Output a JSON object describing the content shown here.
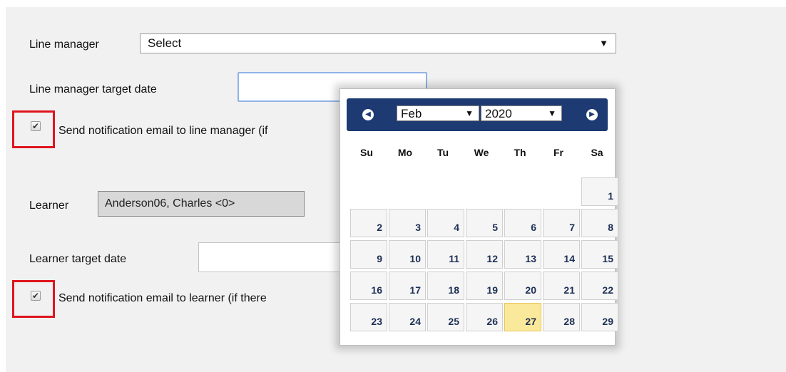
{
  "line_manager": {
    "label": "Line manager",
    "select_value": "Select",
    "arrow": "▼"
  },
  "line_manager_date": {
    "label": "Line manager target date",
    "value": ""
  },
  "line_manager_notify": {
    "label": "Send notification email to line manager (if",
    "checked": true,
    "check_glyph": "✔"
  },
  "learner": {
    "label": "Learner",
    "value": "Anderson06, Charles <0>"
  },
  "learner_date": {
    "label": "Learner target date",
    "value": ""
  },
  "learner_notify": {
    "label": "Send notification email to learner (if there",
    "checked": true,
    "check_glyph": "✔"
  },
  "datepicker": {
    "prev_icon": "◀",
    "next_icon": "▶",
    "month": "Feb",
    "year": "2020",
    "arrow": "▼",
    "weekdays": [
      "Su",
      "Mo",
      "Tu",
      "We",
      "Th",
      "Fr",
      "Sa"
    ],
    "days": [
      "1",
      "2",
      "3",
      "4",
      "5",
      "6",
      "7",
      "8",
      "9",
      "10",
      "11",
      "12",
      "13",
      "14",
      "15",
      "16",
      "17",
      "18",
      "19",
      "20",
      "21",
      "22",
      "23",
      "24",
      "25",
      "26",
      "27",
      "28",
      "29"
    ],
    "selected_day": "27",
    "colors": {
      "header": "#1d3a72",
      "highlight": "#fbe99b",
      "annotation": "#e0141e"
    }
  }
}
